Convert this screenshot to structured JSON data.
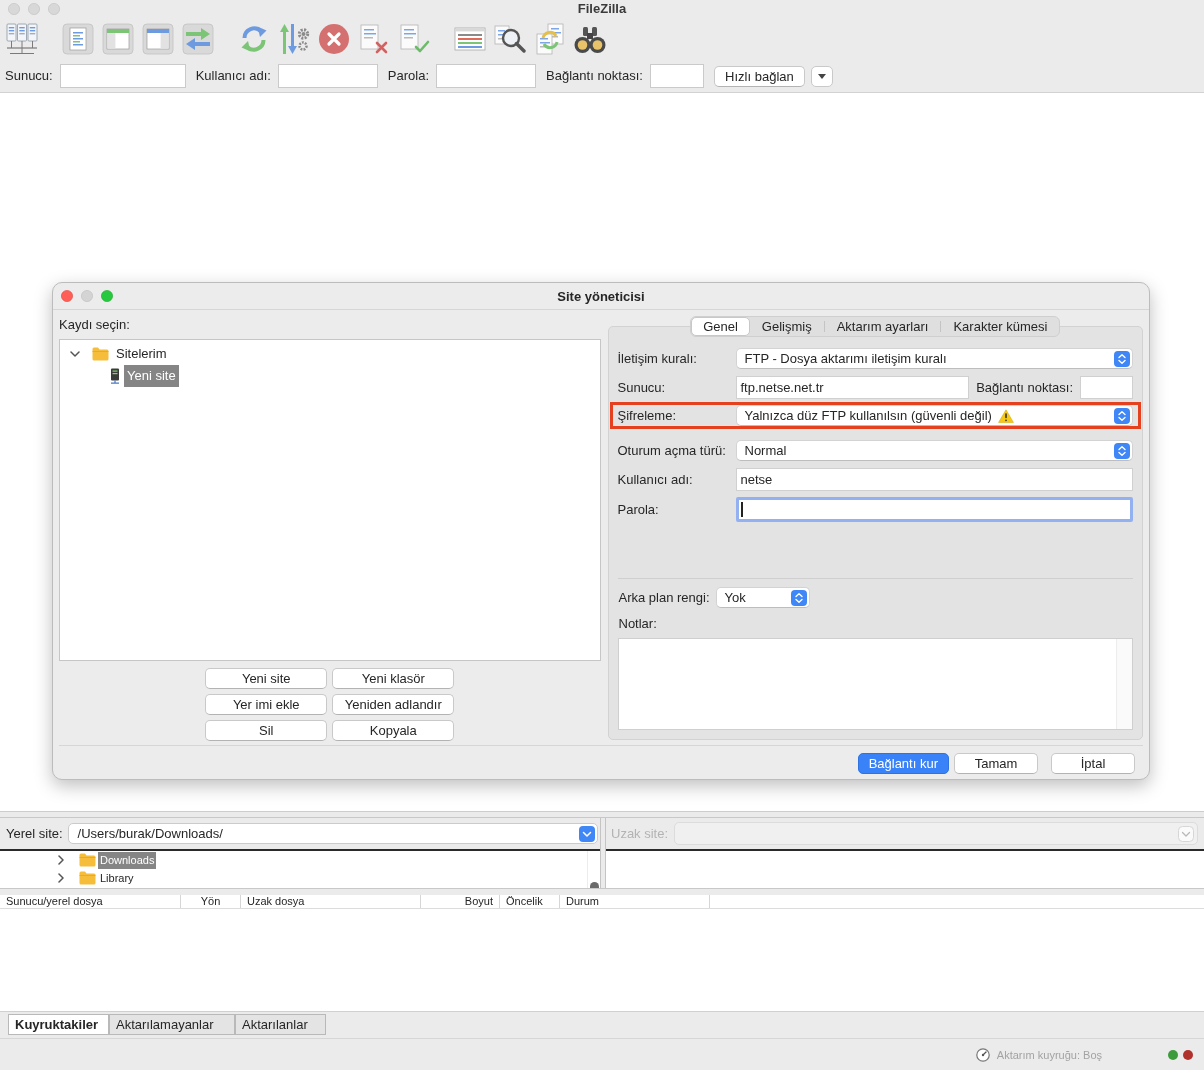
{
  "window": {
    "title": "FileZilla"
  },
  "quickconnect": {
    "fields": [
      {
        "label": "Sunucu:"
      },
      {
        "label": "Kullanıcı adı:"
      },
      {
        "label": "Parola:"
      },
      {
        "label": "Bağlantı noktası:"
      }
    ],
    "button": "Hızlı bağlan"
  },
  "site_manager": {
    "title": "Site yöneticisi",
    "tree_label": "Kaydı seçin:",
    "tree": [
      {
        "label": "Sitelerim",
        "kind": "folder",
        "expanded": true,
        "selected": false,
        "children": [
          {
            "label": "Yeni site",
            "kind": "site",
            "selected": true
          }
        ]
      }
    ],
    "buttons": [
      "Yeni site",
      "Yeni klasör",
      "Yer imi ekle",
      "Yeniden adlandır",
      "Sil",
      "Kopyala"
    ],
    "tabs": [
      {
        "label": "Genel",
        "selected": true
      },
      {
        "label": "Gelişmiş",
        "selected": false
      },
      {
        "label": "Aktarım ayarları",
        "selected": false
      },
      {
        "label": "Karakter kümesi",
        "selected": false
      }
    ],
    "fields": [
      {
        "kind": "select",
        "label": "İletişim kuralı:",
        "value": "FTP - Dosya aktarımı iletişim kuralı",
        "warning": false,
        "highlighted": false
      },
      {
        "kind": "host",
        "label": "Sunucu:",
        "value": "ftp.netse.net.tr",
        "port_label": "Bağlantı noktası:",
        "highlighted": false
      },
      {
        "kind": "select",
        "label": "Şifreleme:",
        "value": "Yalnızca düz FTP kullanılsın (güvenli değil)",
        "warning": true,
        "highlighted": true
      },
      {
        "kind": "select",
        "label": "Oturum açma türü:",
        "value": "Normal",
        "warning": false,
        "highlighted": false
      },
      {
        "kind": "text",
        "label": "Kullanıcı adı:",
        "value": "netse",
        "focused": false,
        "highlighted": false
      },
      {
        "kind": "text",
        "label": "Parola:",
        "focused": true,
        "highlighted": false
      }
    ],
    "background_color": {
      "label": "Arka plan rengi:",
      "value": "Yok"
    },
    "notes": {
      "label": "Notlar:"
    },
    "actions": [
      {
        "label": "Bağlantı kur",
        "primary": true
      },
      {
        "label": "Tamam",
        "primary": false
      },
      {
        "label": "İptal",
        "primary": false
      }
    ]
  },
  "local_site": {
    "label": "Yerel site:",
    "path": "/Users/burak/Downloads/",
    "tree": [
      {
        "label": "Downloads",
        "expanded": false,
        "selected": true
      },
      {
        "label": "Library",
        "expanded": false,
        "selected": false
      }
    ]
  },
  "remote_site": {
    "label": "Uzak site:",
    "disabled": true
  },
  "queue": {
    "columns": [
      "Sunucu/yerel dosya",
      "Yön",
      "Uzak dosya",
      "Boyut",
      "Öncelik",
      "Durum"
    ],
    "tabs": [
      {
        "label": "Kuyruktakiler",
        "selected": true
      },
      {
        "label": "Aktarılamayanlar",
        "selected": false
      },
      {
        "label": "Aktarılanlar",
        "selected": false
      }
    ]
  },
  "status_bar": {
    "queue_status": "Aktarım kuyruğu: Boş",
    "lights": [
      {
        "color": "#3c9c3c"
      },
      {
        "color": "#b0302c"
      }
    ]
  }
}
